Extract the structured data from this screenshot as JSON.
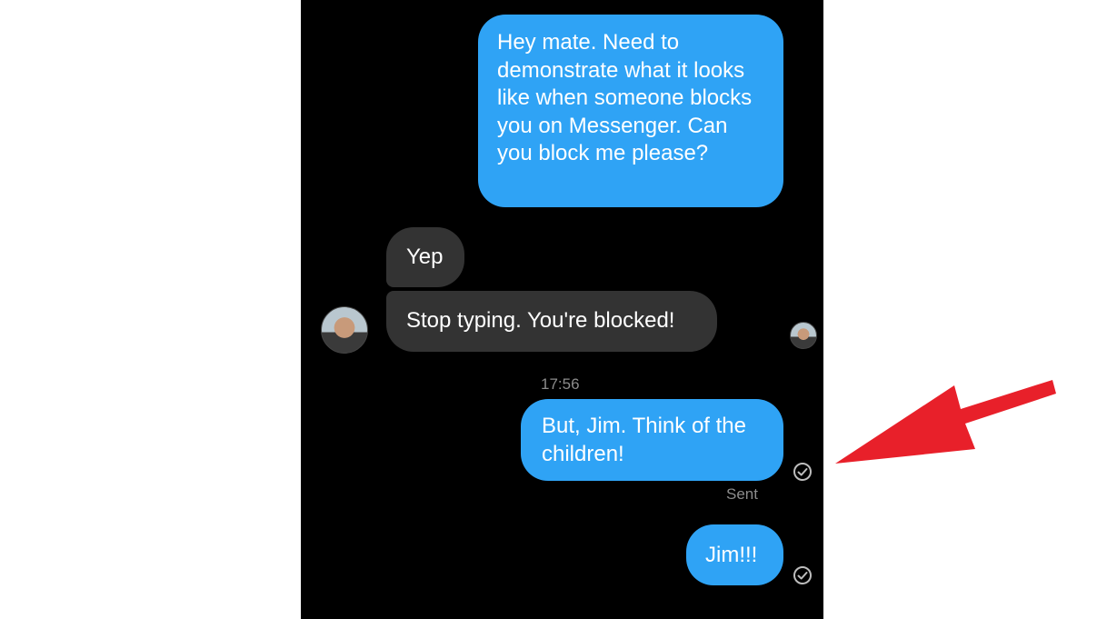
{
  "messages": [
    {
      "id": "msg1",
      "direction": "outgoing",
      "text": "Hey mate. Need to demonstrate what it looks like when someone blocks you on Messenger. Can you block me please?"
    },
    {
      "id": "msg2",
      "direction": "incoming",
      "text": "Yep"
    },
    {
      "id": "msg3",
      "direction": "incoming",
      "text": "Stop typing. You're blocked!"
    },
    {
      "id": "msg4",
      "direction": "outgoing",
      "text": "But, Jim. Think of the children!"
    },
    {
      "id": "msg5",
      "direction": "outgoing",
      "text": "Jim!!!"
    }
  ],
  "timestamp": "17:56",
  "delivery_status": "Sent",
  "icons": {
    "sent_check": "check-circle-icon",
    "annotation": "red-arrow-icon"
  },
  "colors": {
    "outgoing_bubble": "#2fa3f5",
    "incoming_bubble": "#333333",
    "background": "#000000",
    "annotation_arrow": "#e8202a",
    "meta_text": "#8c8c8c"
  }
}
